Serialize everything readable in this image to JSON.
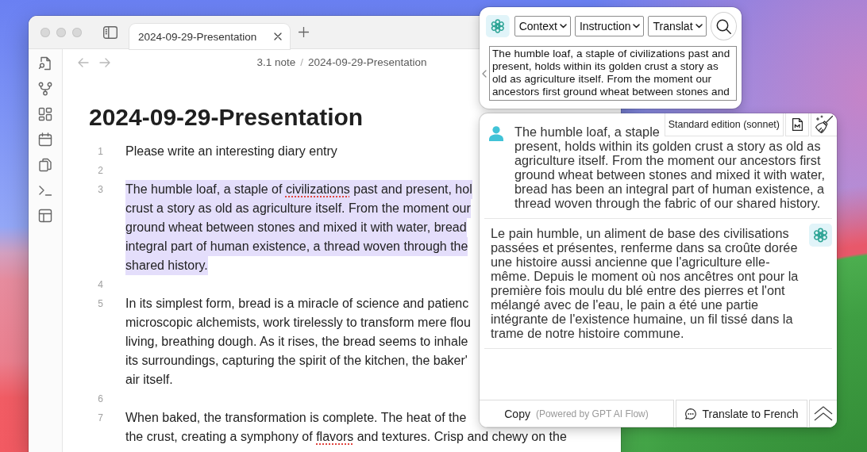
{
  "editor_window": {
    "tabs": [
      {
        "label": "2024-09-29-Presentation",
        "selected": true
      }
    ],
    "breadcrumb": {
      "parent": "3.1 note",
      "separator": "/",
      "current": "2024-09-29-Presentation"
    },
    "note": {
      "title": "2024-09-29-Presentation",
      "lines": [
        {
          "number": "1",
          "selected": false,
          "rows": [
            "Please write an interesting diary entry"
          ]
        },
        {
          "number": "2",
          "selected": false
        },
        {
          "number": "3",
          "selected": true,
          "rows": [
            {
              "runs": [
                {
                  "text": "The humble loaf, a staple of ",
                  "misspelled": false
                },
                {
                  "text": "civilizations",
                  "misspelled": true
                },
                {
                  "text": " past and present, hol",
                  "misspelled": false
                }
              ]
            },
            "crust a story as old as agriculture itself. From the moment our",
            "ground wheat between stones and mixed it with water, bread",
            "integral part of human existence, a thread woven through the",
            "shared history."
          ]
        },
        {
          "number": "4",
          "selected": false
        },
        {
          "number": "5",
          "selected": false,
          "rows": [
            "In its simplest form, bread is a miracle of science and patienc",
            "microscopic alchemists, work tirelessly to transform mere flou",
            "living, breathing dough. As it rises, the bread seems to inhale",
            "its surroundings, capturing the spirit of the kitchen, the baker'",
            "air itself."
          ]
        },
        {
          "number": "6",
          "selected": false
        },
        {
          "number": "7",
          "selected": false,
          "rows": [
            "When baked, the transformation is complete. The heat of the",
            {
              "runs": [
                {
                  "text": "the crust, creating a symphony of ",
                  "misspelled": false
                },
                {
                  "text": "flavors",
                  "misspelled": true
                },
                {
                  "text": " and textures. Crisp and chewy on the",
                  "misspelled": false
                }
              ]
            }
          ]
        }
      ]
    }
  },
  "prompt_popup": {
    "selects": [
      {
        "value": "Context"
      },
      {
        "value": "Instruction"
      },
      {
        "value": "Translat"
      }
    ],
    "prompt": {
      "value": "The humble loaf, a staple of civilizations past and present, holds within its golden crust a story as old as agriculture itself. From the moment our ancestors first ground wheat between stones and"
    }
  },
  "chat_panel": {
    "model_label": "Standard edition (sonnet)",
    "messages": [
      {
        "kind": "user",
        "lines": [
          "The humble loaf, a staple",
          "present, holds within its golden crust a story as old as",
          "agriculture itself. From the moment our ancestors first",
          "ground wheat between stones and mixed it with water,",
          "bread has been an integral part of human existence, a",
          "thread woven through the fabric of our shared history."
        ]
      },
      {
        "kind": "assistant",
        "lines": [
          "Le pain humble, un aliment de base des civilisations",
          "passées et présentes, renferme dans sa croûte dorée",
          "une histoire aussi ancienne que l'agriculture elle-",
          "même. Depuis le moment où nos ancêtres ont pour la",
          "première fois moulu du blé entre des pierres et l'ont",
          "mélangé avec de l'eau, le pain a été une partie",
          "intégrante de l'existence humaine, un fil tissé dans la",
          "trame de notre histoire commune."
        ]
      }
    ],
    "footer": {
      "copy_label": "Copy",
      "powered_by": "(Powered by GPT AI Flow)",
      "action_label": "Translate to French"
    }
  }
}
